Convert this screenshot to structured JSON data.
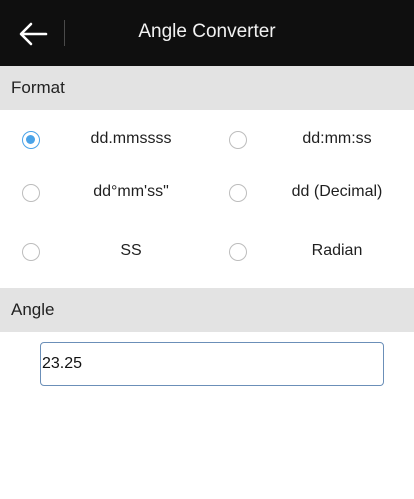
{
  "appbar": {
    "title": "Angle Converter",
    "back_icon": "arrow-left-icon"
  },
  "format": {
    "header": "Format",
    "options": [
      {
        "label": "dd.mmssss",
        "selected": true
      },
      {
        "label": "dd:mm:ss",
        "selected": false
      },
      {
        "label": "dd°mm'ss\"",
        "selected": false
      },
      {
        "label": "dd (Decimal)",
        "selected": false
      },
      {
        "label": "SS",
        "selected": false
      },
      {
        "label": "Radian",
        "selected": false
      }
    ]
  },
  "angle": {
    "header": "Angle",
    "value": "23.25"
  },
  "colors": {
    "accent": "#4aa3e8",
    "appbar": "#0f0f0f",
    "section_header": "#e3e3e3"
  }
}
